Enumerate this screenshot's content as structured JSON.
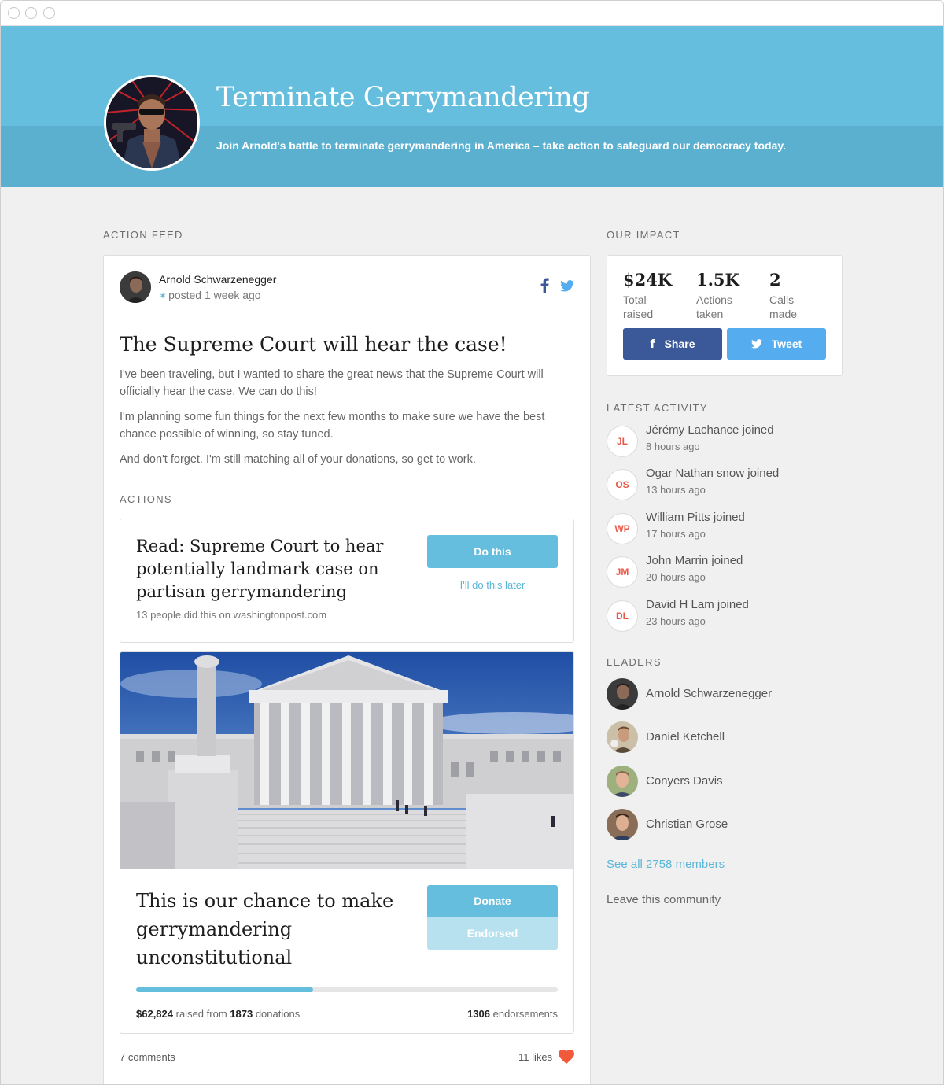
{
  "hero": {
    "title": "Terminate Gerrymandering",
    "subtitle": "Join Arnold's battle to terminate gerrymandering in America – take action to safeguard our democracy today.",
    "color": "#65bedd"
  },
  "feed": {
    "section_label": "ACTION FEED",
    "post": {
      "author": "Arnold Schwarzenegger",
      "posted": "posted 1 week ago",
      "title": "The Supreme Court will hear the case!",
      "paragraphs": [
        "I've been traveling, but I wanted to share the great news that the Supreme Court will officially hear the case. We can do this!",
        "I'm planning some fun things for the next few months to make sure we have the best chance possible of winning, so stay tuned.",
        "And don't forget. I'm still matching all of your donations, so get to work."
      ],
      "actions_label": "ACTIONS",
      "action": {
        "title": "Read: Supreme Court to hear potentially landmark case on partisan gerrymandering",
        "meta": "13 people did this on washingtonpost.com",
        "do_label": "Do this",
        "later_label": "I'll do this later"
      },
      "donation": {
        "title": "This is our chance to make gerrymandering unconstitutional",
        "donate_label": "Donate",
        "endorsed_label": "Endorsed",
        "progress": 0.42,
        "raised_amount": "$62,824",
        "raised_from": "raised from",
        "donations_count": "1873",
        "donations_word": "donations",
        "endorsements_count": "1306",
        "endorsements_word": "endorsements"
      },
      "comments": "7 comments",
      "likes": "11 likes"
    }
  },
  "impact": {
    "section_label": "OUR IMPACT",
    "stats": [
      {
        "value": "$24K",
        "label": "Total raised"
      },
      {
        "value": "1.5K",
        "label": "Actions taken"
      },
      {
        "value": "2",
        "label": "Calls made"
      }
    ],
    "share_label": "Share",
    "tweet_label": "Tweet",
    "share_color": "#3b5998",
    "tweet_color": "#55acee"
  },
  "activity": {
    "section_label": "LATEST ACTIVITY",
    "items": [
      {
        "initials": "JL",
        "text": "Jérémy Lachance joined",
        "time": "8 hours ago"
      },
      {
        "initials": "OS",
        "text": "Ogar Nathan snow joined",
        "time": "13 hours ago"
      },
      {
        "initials": "WP",
        "text": "William Pitts joined",
        "time": "17 hours ago"
      },
      {
        "initials": "JM",
        "text": "John Marrin joined",
        "time": "20 hours ago"
      },
      {
        "initials": "DL",
        "text": "David H Lam joined",
        "time": "23 hours ago"
      }
    ]
  },
  "leaders": {
    "section_label": "LEADERS",
    "items": [
      {
        "name": "Arnold Schwarzenegger"
      },
      {
        "name": "Daniel Ketchell"
      },
      {
        "name": "Conyers Davis"
      },
      {
        "name": "Christian Grose"
      }
    ],
    "see_all": "See all 2758 members",
    "leave": "Leave this community"
  }
}
